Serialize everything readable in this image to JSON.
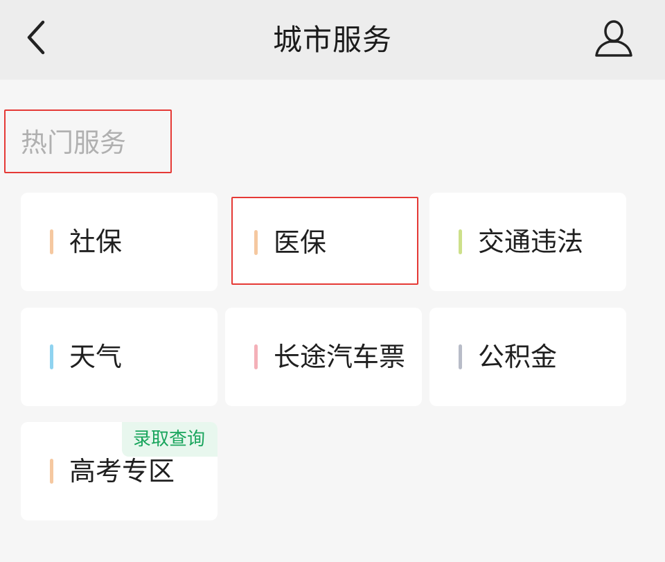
{
  "header": {
    "title": "城市服务",
    "back_icon": "chevron-left-icon",
    "profile_icon": "user-icon"
  },
  "section": {
    "title": "热门服务"
  },
  "services": [
    {
      "label": "社保",
      "accent": "#f5c8a0"
    },
    {
      "label": "医保",
      "accent": "#f5c8a0"
    },
    {
      "label": "交通违法",
      "accent": "#cde08a"
    },
    {
      "label": "天气",
      "accent": "#8fd3f0"
    },
    {
      "label": "长途汽车票",
      "accent": "#f4b0b8"
    },
    {
      "label": "公积金",
      "accent": "#b8bcc8"
    },
    {
      "label": "高考专区",
      "accent": "#f5c8a0",
      "badge": "录取查询"
    }
  ],
  "colors": {
    "highlight_border": "#e53935",
    "badge_text": "#1aa55d",
    "badge_bg": "#e8f7ee"
  }
}
